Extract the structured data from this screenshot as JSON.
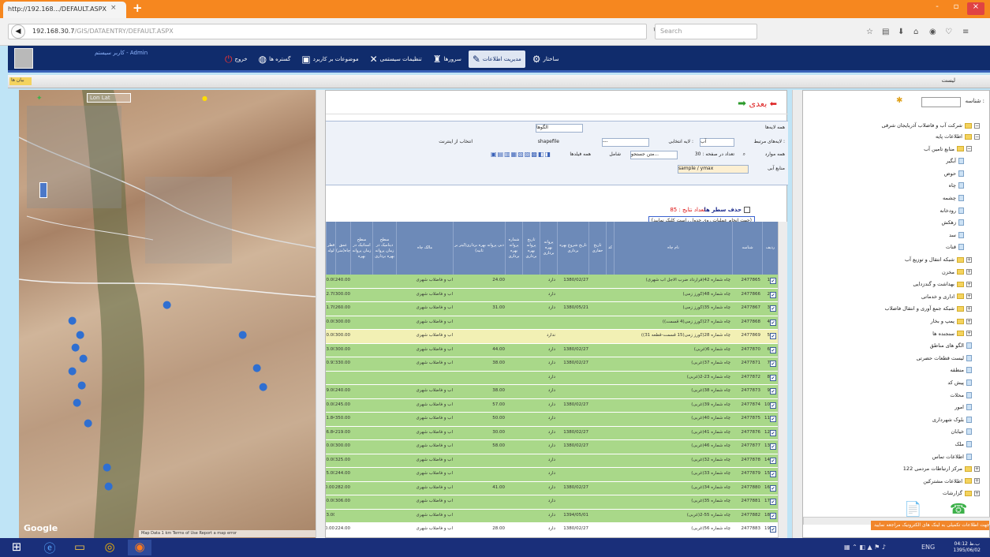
{
  "browser": {
    "tab_title": "http://192.168.../DEFAULT.ASPX",
    "tab_close": "×",
    "new_tab": "+",
    "url_host": "192.168.30.7",
    "url_path": "/GIS/DATAENTRY/DEFAULT.ASPX",
    "search_placeholder": "Search",
    "win_min": "-",
    "win_max": "▫",
    "win_close": "×"
  },
  "app": {
    "user_label": "کاربر سیستم - Admin",
    "menu": [
      {
        "label": "ساختار",
        "icon": "structure-icon"
      },
      {
        "label": "مدیریت اطلاعات",
        "icon": "data-management-icon",
        "active": true
      },
      {
        "label": "سرورها",
        "icon": "servers-icon"
      },
      {
        "label": "تنظیمات سیستمی",
        "icon": "tools-icon"
      },
      {
        "label": "موضوعات بر کاربرد",
        "icon": "topics-icon"
      },
      {
        "label": "گستره ها",
        "icon": "extent-icon"
      },
      {
        "label": "خروج",
        "icon": "power-icon"
      }
    ],
    "subbar_title": "لیست",
    "fav_label": "بیان ها"
  },
  "map": {
    "latlon_label": "Lon Lat",
    "google_label": "Google",
    "footer": "Map Data  1 km  Terms of Use  Report a map error"
  },
  "center": {
    "forward_label": "بعدی",
    "filters": {
      "all_layers": "همه لایه‌ها",
      "layer_select": "الگوها",
      "related_layers": "لایه‌های مرتبط :",
      "related_value": "آب",
      "selected_layer": "لایه انتخابی :",
      "selected_value": "---",
      "shapefile": "shapefile",
      "internet_chk": "انتخاب از اینترنت",
      "all_fields": "همه فیلدها",
      "contains": "شامل",
      "search_text": "متن جستجو...",
      "page_size": "تعداد در صفحه : 30",
      "all_items": "همه موارد",
      "sort": "منابع آبی",
      "sample": "sample / ymax"
    },
    "delete_rows": "حذف سطر ها",
    "record_count": "تعداد نتایج : 85",
    "hint": "(جهت انجام عملیات روی جدول راست کلیک نمایید)",
    "columns": [
      "ردیف",
      "شناسه",
      "نام چاه",
      "کد",
      "تاریخ حفاری",
      "تاریخ شروع بهره برداری",
      "پروانه بهره برداری",
      "تاریخ پروانه بهره برداری",
      "شماره پروانه بهره برداری",
      "دبی پروانه بهره برداری(لیتر بر ثانیه)",
      "مالک چاه",
      "سطح دینامیک در زمان پروانه بهره برداری",
      "سطح استاتیک در زمان پروانه بهره",
      "عمق چاه(متر)",
      "قطر لوله"
    ],
    "rows": [
      {
        "n": "1",
        "id": "2477865",
        "name": "چاه شماره 42(قرارداد ضرب الاجل آب شهری)",
        "date": "1380/02/27",
        "pv": "دارد",
        "q": "24.00",
        "owner": "آب و فاضلاب شهری",
        "depth": "240.00",
        "dia": "20.00",
        "color": "green"
      },
      {
        "n": "2",
        "id": "2477866",
        "name": "چاه شماره 48(گورز زمی)",
        "date": "",
        "pv": "دارد",
        "q": "",
        "owner": "آب و فاضلاب شهری",
        "depth": "300.00",
        "dia": "32.78",
        "color": "green"
      },
      {
        "n": "3",
        "id": "2477867",
        "name": "چاه شماره 35(گورز زمی)",
        "date": "1380/05/21",
        "pv": "دارد",
        "q": "31.00",
        "owner": "آب و فاضلاب شهری",
        "depth": "260.00",
        "dia": "21.78",
        "color": "green"
      },
      {
        "n": "4",
        "id": "2477868",
        "name": "چاه شماره 27(گورز زمی(4 قسمت))",
        "date": "",
        "pv": "",
        "q": "",
        "owner": "آب و فاضلاب شهری",
        "depth": "300.00",
        "dia": "40.00",
        "color": "green"
      },
      {
        "n": "5",
        "id": "2477869",
        "name": "چاه شماره 28(گورز زمی(15 قسمت-قطعه 31))",
        "date": "",
        "pv": "ندارد",
        "q": "",
        "owner": "آب و فاضلاب شهری",
        "depth": "300.00",
        "dia": "20.00",
        "color": "yellow"
      },
      {
        "n": "6",
        "id": "2477870",
        "name": "چاه شماره 6(غربی)",
        "date": "1380/02/27",
        "pv": "دارد",
        "q": "44.00",
        "owner": "آب و فاضلاب شهری",
        "depth": "300.00",
        "dia": "13.00",
        "color": "green"
      },
      {
        "n": "7",
        "id": "2477871",
        "name": "چاه شماره 37(غربی)",
        "date": "1380/02/27",
        "pv": "دارد",
        "q": "38.00",
        "owner": "آب و فاضلاب شهری",
        "depth": "330.00",
        "dia": "20.93",
        "color": "green"
      },
      {
        "n": "8",
        "id": "2477872",
        "name": "چاه شماره 23-2(غربی)",
        "date": "",
        "pv": "دارد",
        "q": "",
        "owner": "",
        "depth": "",
        "dia": "",
        "color": "green"
      },
      {
        "n": "9",
        "id": "2477873",
        "name": "چاه شماره 38(غربی)",
        "date": "",
        "pv": "دارد",
        "q": "38.00",
        "owner": "آب و فاضلاب شهری",
        "depth": "240.00",
        "dia": "19.00",
        "color": "green"
      },
      {
        "n": "10",
        "id": "2477874",
        "name": "چاه شماره 39(غربی)",
        "date": "1380/02/27",
        "pv": "دارد",
        "q": "57.00",
        "owner": "آب و فاضلاب شهری",
        "depth": "245.00",
        "dia": "30.00",
        "color": "green"
      },
      {
        "n": "11",
        "id": "2477875",
        "name": "چاه شماره 40(غربی)",
        "date": "",
        "pv": "دارد",
        "q": "50.00",
        "owner": "آب و فاضلاب شهری",
        "depth": "350.00",
        "dia": "21.84",
        "color": "green"
      },
      {
        "n": "12",
        "id": "2477876",
        "name": "چاه شماره 41(غربی)",
        "date": "1380/02/27",
        "pv": "دارد",
        "q": "30.00",
        "owner": "آب و فاضلاب شهری",
        "depth": "219.00",
        "dia": "26.84",
        "color": "green"
      },
      {
        "n": "13",
        "id": "2477877",
        "name": "چاه شماره 46(غربی)",
        "date": "1380/02/27",
        "pv": "دارد",
        "q": "58.00",
        "owner": "آب و فاضلاب شهری",
        "depth": "300.00",
        "dia": "30.00",
        "color": "green"
      },
      {
        "n": "14",
        "id": "2477878",
        "name": "چاه شماره 32(غربی)",
        "date": "",
        "pv": "دارد",
        "q": "",
        "owner": "آب و فاضلاب شهری",
        "depth": "325.00",
        "dia": "20.00",
        "color": "green"
      },
      {
        "n": "15",
        "id": "2477879",
        "name": "چاه شماره 33(غربی)",
        "date": "",
        "pv": "دارد",
        "q": "",
        "owner": "آب و فاضلاب شهری",
        "depth": "244.00",
        "dia": "25.00",
        "color": "green"
      },
      {
        "n": "16",
        "id": "2477880",
        "name": "چاه شماره 34(غربی)",
        "date": "1380/02/27",
        "pv": "دارد",
        "q": "41.00",
        "owner": "آب و فاضلاب شهری",
        "depth": "282.00",
        "dia": "0.00",
        "color": "green"
      },
      {
        "n": "17",
        "id": "2477881",
        "name": "چاه شماره 35(غربی)",
        "date": "",
        "pv": "دارد",
        "q": "",
        "owner": "آب و فاضلاب شهری",
        "depth": "306.00",
        "dia": "40.00",
        "color": "green"
      },
      {
        "n": "18",
        "id": "2477882",
        "name": "چاه شماره 55-2(غربی)",
        "date": "1394/05/01",
        "pv": "دارد",
        "q": "",
        "owner": "آب و فاضلاب شهری",
        "depth": "",
        "dia": "23.00",
        "color": "green"
      },
      {
        "n": "19",
        "id": "2477883",
        "name": "چاه شماره 56(غربی)",
        "date": "1380/02/27",
        "pv": "دارد",
        "q": "28.00",
        "owner": "آب و فاضلاب شهری",
        "depth": "224.00",
        "dia": "0.00",
        "color": "white"
      }
    ]
  },
  "tree": {
    "search_label": "شناسه :",
    "root": "شرکت آب و فاضلاب آذربایجان شرقی",
    "nodes": [
      {
        "label": "اطلاعات پایه",
        "type": "folder",
        "level": 1,
        "expander": "−"
      },
      {
        "label": "منابع تامین آب",
        "type": "folder",
        "level": 2,
        "expander": "−"
      },
      {
        "label": "آبگیر",
        "type": "leaf",
        "level": 3
      },
      {
        "label": "حوض",
        "type": "leaf",
        "level": 3
      },
      {
        "label": "چاه",
        "type": "leaf",
        "level": 3
      },
      {
        "label": "چشمه",
        "type": "leaf",
        "level": 3
      },
      {
        "label": "رودخانه",
        "type": "leaf",
        "level": 3
      },
      {
        "label": "زهکش",
        "type": "leaf",
        "level": 3
      },
      {
        "label": "سد",
        "type": "leaf",
        "level": 3
      },
      {
        "label": "قنات",
        "type": "leaf",
        "level": 3
      },
      {
        "label": "شبکه انتقال و توزیع آب",
        "type": "folder",
        "level": 2,
        "expander": "+"
      },
      {
        "label": "مخزن",
        "type": "folder",
        "level": 2,
        "expander": "+"
      },
      {
        "label": "بهداشت و گندزدایی",
        "type": "folder",
        "level": 2,
        "expander": "+"
      },
      {
        "label": "اداری و خدماتی",
        "type": "folder",
        "level": 2,
        "expander": "+"
      },
      {
        "label": "شبکه جمع آوری و انتقال فاضلاب",
        "type": "folder",
        "level": 2,
        "expander": "+"
      },
      {
        "label": "پمپ و بخار",
        "type": "folder",
        "level": 2,
        "expander": "+"
      },
      {
        "label": "سنجنده ها",
        "type": "folder",
        "level": 2,
        "expander": "+"
      },
      {
        "label": "الگو های مناطق",
        "type": "leaf",
        "level": 2
      },
      {
        "label": "لیست قطعات حضرتی",
        "type": "leaf",
        "level": 2
      },
      {
        "label": "منطقه",
        "type": "leaf",
        "level": 2
      },
      {
        "label": "پیش کد",
        "type": "leaf",
        "level": 2
      },
      {
        "label": "محلات",
        "type": "leaf",
        "level": 2
      },
      {
        "label": "امور",
        "type": "leaf",
        "level": 2
      },
      {
        "label": "بلوک شهرداری",
        "type": "leaf",
        "level": 2
      },
      {
        "label": "خیابان",
        "type": "leaf",
        "level": 2
      },
      {
        "label": "ملک",
        "type": "leaf",
        "level": 2
      },
      {
        "label": "اطلاعات تماس",
        "type": "leaf",
        "level": 2
      },
      {
        "label": "مرکز ارتباطات مردمی 122",
        "type": "folder",
        "level": 1,
        "expander": "+"
      },
      {
        "label": "اطلاعات مشترکین",
        "type": "folder",
        "level": 1,
        "expander": "+"
      },
      {
        "label": "گزارشات",
        "type": "folder",
        "level": 1,
        "expander": "+"
      }
    ],
    "status_bar": "جهت اطلاعات تکمیلی به لینک های الکترونیک مراجعه نمایید"
  },
  "taskbar": {
    "time": "04:12 ب.ظ",
    "date": "1395/06/02",
    "lang": "ENG"
  },
  "colors": {
    "row_green": "#a9d889",
    "row_yellow": "#f2f0b4",
    "header_blue": "#6d8ab8",
    "app_navy": "#102c6c",
    "tab_orange": "#f6871f"
  }
}
